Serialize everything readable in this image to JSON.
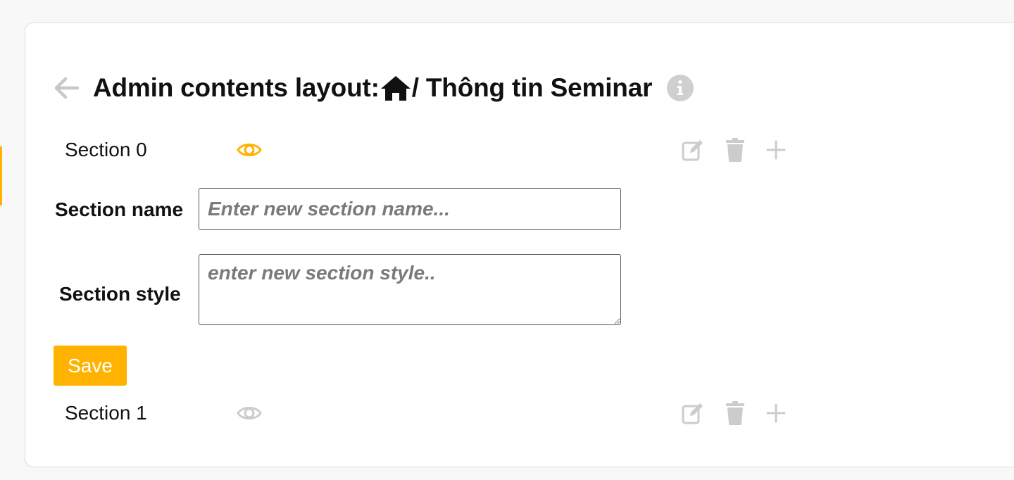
{
  "header": {
    "title_prefix": "Admin contents layout:",
    "title_path": "/ Thông tin Seminar",
    "back_icon": "arrow-left-icon",
    "home_icon": "home-icon",
    "info_icon": "info-circle-icon"
  },
  "sections": [
    {
      "label": "Section 0",
      "visible": true
    },
    {
      "label": "Section 1",
      "visible": false
    }
  ],
  "form": {
    "name_label": "Section name",
    "name_placeholder": "Enter new section name...",
    "name_value": "",
    "style_label": "Section style",
    "style_placeholder": "enter new section style..",
    "style_value": "",
    "save_label": "Save"
  },
  "colors": {
    "accent": "#ffb300",
    "icon_muted": "#cccccc",
    "text": "#111111"
  }
}
